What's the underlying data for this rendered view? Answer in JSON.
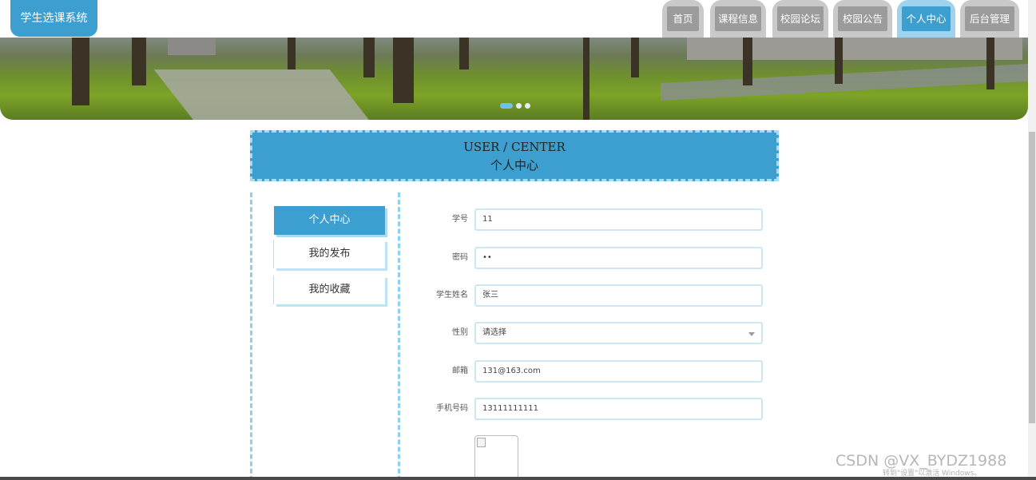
{
  "app": {
    "title": "学生选课系统"
  },
  "nav": {
    "items": [
      {
        "label": "首页"
      },
      {
        "label": "课程信息"
      },
      {
        "label": "校园论坛"
      },
      {
        "label": "校园公告"
      },
      {
        "label": "个人中心",
        "active": true
      },
      {
        "label": "后台管理"
      }
    ]
  },
  "banner": {
    "slide_count": 3,
    "active_slide": 1
  },
  "center": {
    "title_en": "USER / CENTER",
    "title_cn": "个人中心"
  },
  "side_menu": {
    "items": [
      {
        "label": "个人中心",
        "active": true
      },
      {
        "label": "我的发布"
      },
      {
        "label": "我的收藏"
      }
    ]
  },
  "form": {
    "student_no": {
      "label": "学号",
      "value": "11"
    },
    "password": {
      "label": "密码",
      "value": "••"
    },
    "student_name": {
      "label": "学生姓名",
      "value": "张三"
    },
    "gender": {
      "label": "性别",
      "value": "请选择"
    },
    "email": {
      "label": "邮箱",
      "value": "131@163.com"
    },
    "phone": {
      "label": "手机号码",
      "value": "13111111111"
    }
  },
  "watermark": {
    "text": "CSDN @VX_BYDZ1988",
    "activate_text": "转到\"设置\"以激活 Windows。"
  },
  "colors": {
    "primary": "#3d9fd0",
    "accent_light": "#a8dcf5",
    "nav_inactive": "#9b9b9b"
  }
}
